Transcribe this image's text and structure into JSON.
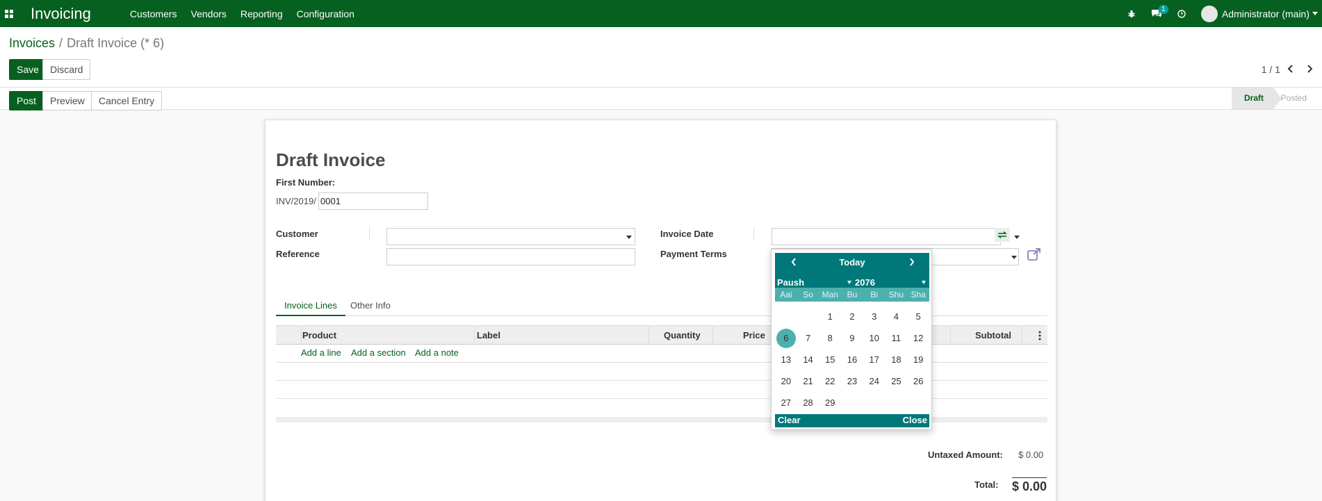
{
  "navbar": {
    "app_name": "Invoicing",
    "menu": [
      "Customers",
      "Vendors",
      "Reporting",
      "Configuration"
    ],
    "messages_badge": "1",
    "user": "Administrator (main)",
    "icons": [
      "apps-grid-icon",
      "bug-icon",
      "chat-icon",
      "clock-icon",
      "avatar"
    ]
  },
  "breadcrumb": {
    "parent": "Invoices",
    "separator": "/",
    "current": "Draft Invoice (* 6)"
  },
  "buttons": {
    "save": "Save",
    "discard": "Discard",
    "post": "Post",
    "preview": "Preview",
    "cancel_entry": "Cancel Entry"
  },
  "pager": {
    "value": "1 / 1"
  },
  "status": {
    "draft": "Draft",
    "posted": "Posted",
    "active": "Draft"
  },
  "form": {
    "title": "Draft Invoice",
    "first_number_label": "First Number:",
    "number_prefix": "INV/2019/",
    "number_value": "0001",
    "customer_label": "Customer",
    "reference_label": "Reference",
    "invoice_date_label": "Invoice Date",
    "payment_terms_label": "Payment Terms"
  },
  "tabs": [
    "Invoice Lines",
    "Other Info"
  ],
  "table": {
    "columns": [
      "Product",
      "Label",
      "Quantity",
      "Price",
      "Subtotal"
    ],
    "add_links": [
      "Add a line",
      "Add a section",
      "Add a note"
    ]
  },
  "totals": {
    "untaxed_label": "Untaxed Amount:",
    "untaxed_value": "$ 0.00",
    "total_label": "Total:",
    "total_value": "$ 0.00"
  },
  "datepicker": {
    "today": "Today",
    "month": "Paush",
    "year": "2076",
    "weekdays": [
      "Aai",
      "So",
      "Man",
      "Bu",
      "Bi",
      "Shu",
      "Sha"
    ],
    "days": [
      "",
      "",
      "1",
      "2",
      "3",
      "4",
      "5",
      "6",
      "7",
      "8",
      "9",
      "10",
      "11",
      "12",
      "13",
      "14",
      "15",
      "16",
      "17",
      "18",
      "19",
      "20",
      "21",
      "22",
      "23",
      "24",
      "25",
      "26",
      "27",
      "28",
      "29"
    ],
    "selected": "6",
    "clear": "Clear",
    "close": "Close"
  },
  "colors": {
    "brand": "#06601f",
    "datepicker_header": "#00787a",
    "datepicker_accent": "#4cb0ae",
    "badge": "#00a09d"
  }
}
